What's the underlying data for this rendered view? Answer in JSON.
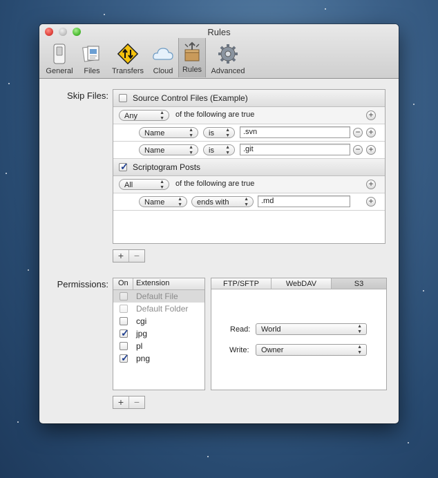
{
  "window": {
    "title": "Rules"
  },
  "toolbar": {
    "items": [
      {
        "label": "General",
        "icon": "general-switch-icon"
      },
      {
        "label": "Files",
        "icon": "files-icon"
      },
      {
        "label": "Transfers",
        "icon": "transfers-sign-icon"
      },
      {
        "label": "Cloud",
        "icon": "cloud-icon"
      },
      {
        "label": "Rules",
        "icon": "rules-box-icon",
        "selected": true
      },
      {
        "label": "Advanced",
        "icon": "gear-icon"
      }
    ]
  },
  "skip_files": {
    "label": "Skip Files:",
    "rules": [
      {
        "name": "Source Control Files (Example)",
        "checked": false,
        "match_mode": "Any",
        "match_text": "of the following are true",
        "conditions": [
          {
            "field": "Name",
            "operator": "is",
            "value": ".svn"
          },
          {
            "field": "Name",
            "operator": "is",
            "value": ".git"
          }
        ]
      },
      {
        "name": "Scriptogram Posts",
        "checked": true,
        "match_mode": "All",
        "match_text": "of the following are true",
        "conditions": [
          {
            "field": "Name",
            "operator": "ends with",
            "value": ".md"
          }
        ]
      }
    ],
    "add_label": "+",
    "remove_label": "−"
  },
  "permissions": {
    "label": "Permissions:",
    "columns": {
      "on": "On",
      "extension": "Extension"
    },
    "rows": [
      {
        "name": "Default File",
        "checked": false,
        "selected": true
      },
      {
        "name": "Default Folder",
        "checked": false
      },
      {
        "name": "cgi",
        "checked": false
      },
      {
        "name": "jpg",
        "checked": true
      },
      {
        "name": "pl",
        "checked": false
      },
      {
        "name": "png",
        "checked": true
      }
    ],
    "tabs": [
      "FTP/SFTP",
      "WebDAV",
      "S3"
    ],
    "selected_tab": "S3",
    "read_label": "Read:",
    "read_value": "World",
    "write_label": "Write:",
    "write_value": "Owner",
    "add_label": "+",
    "remove_label": "−"
  },
  "colors": {
    "accent": "#1f3f8f",
    "close": "#e0443e",
    "zoom": "#4fbd35"
  }
}
